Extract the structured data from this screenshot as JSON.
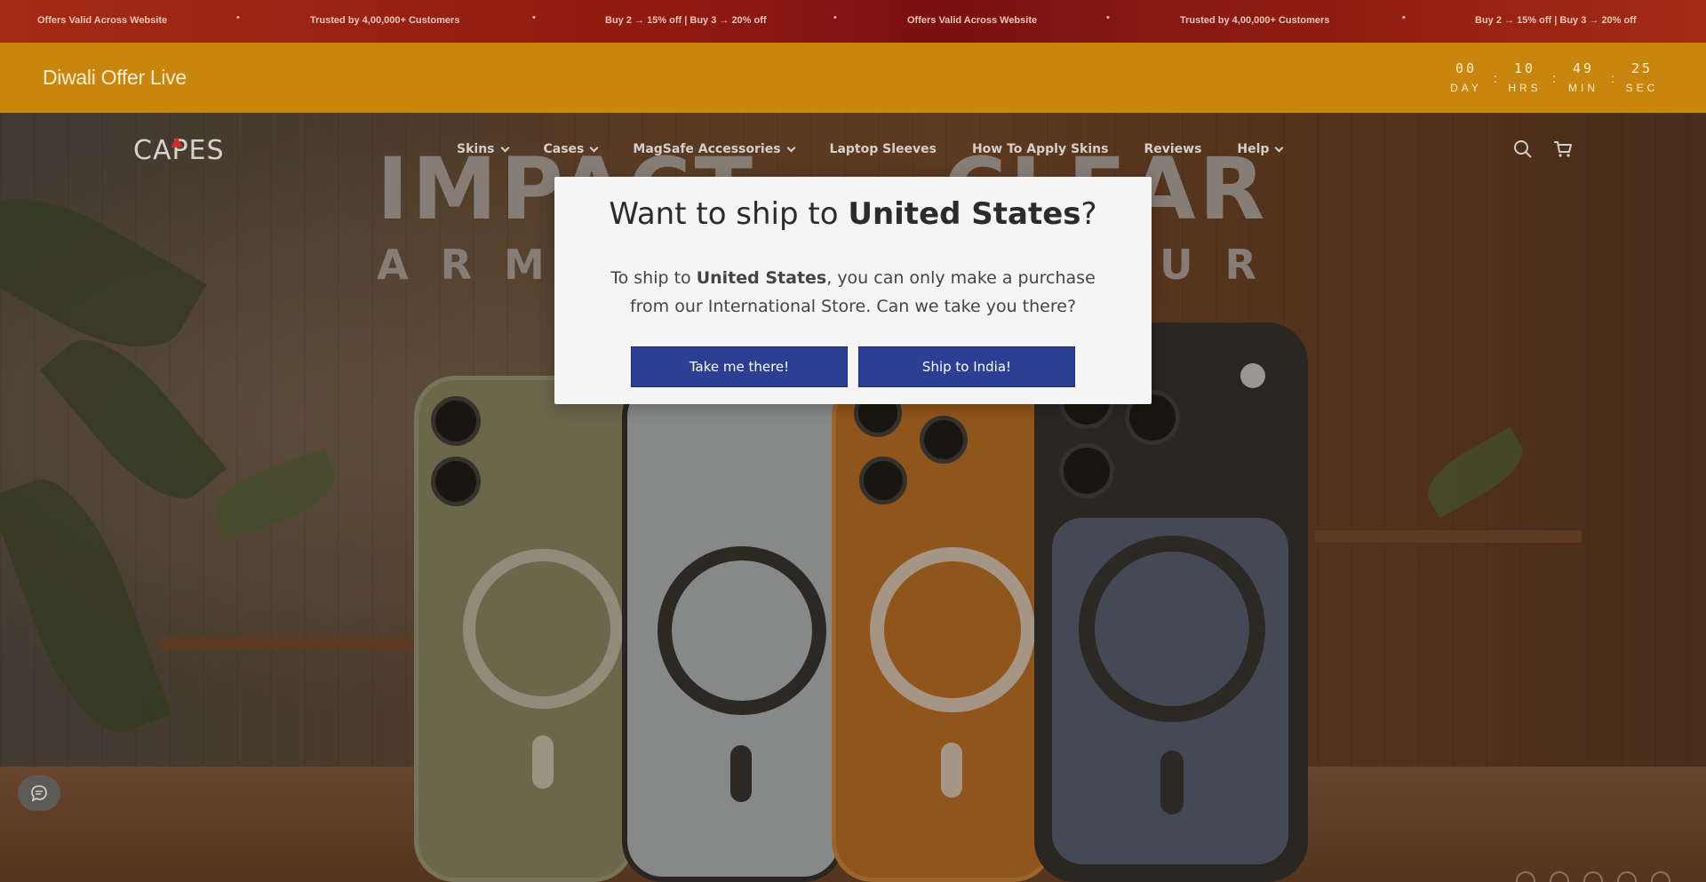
{
  "announcement": {
    "items": [
      "Offers Valid Across Website",
      "Trusted by 4,00,000+ Customers",
      "Buy 2 → 15% off | Buy 3 → 20% off",
      "Offers Valid Across Website",
      "Trusted by 4,00,000+ Customers",
      "Buy 2 → 15% off | Buy 3 → 20% off"
    ],
    "separator": "•"
  },
  "offer": {
    "title": "Diwali Offer Live",
    "countdown": [
      {
        "value": "00",
        "label": "DAY"
      },
      {
        "value": "10",
        "label": "HRS"
      },
      {
        "value": "49",
        "label": "MIN"
      },
      {
        "value": "25",
        "label": "SEC"
      }
    ],
    "separator": ":"
  },
  "header": {
    "logo": "CAPES",
    "nav": [
      {
        "label": "Skins",
        "dropdown": true
      },
      {
        "label": "Cases",
        "dropdown": true
      },
      {
        "label": "MagSafe Accessories",
        "dropdown": true
      },
      {
        "label": "Laptop Sleeves",
        "dropdown": false
      },
      {
        "label": "How To Apply Skins",
        "dropdown": false
      },
      {
        "label": "Reviews",
        "dropdown": false
      },
      {
        "label": "Help",
        "dropdown": true
      }
    ],
    "icons": [
      "search-icon",
      "cart-icon"
    ]
  },
  "hero": {
    "headline_left": "IMPACT",
    "headline_right": "CLEAR",
    "sub_left": "ARM",
    "sub_right": "OUR"
  },
  "modal": {
    "title_pre": "Want to ship to ",
    "title_country": "United States",
    "title_post": "?",
    "body_pre": "To ship to ",
    "body_country": "United States",
    "body_post": ", you can only make a purchase from our International Store. Can we take you there?",
    "primary_button": "Take me there!",
    "secondary_button": "Ship to India!"
  },
  "colors": {
    "announcement_bg": "#8e1a12",
    "offer_bg": "#c8860f",
    "button_bg": "#2d3f94",
    "modal_bg": "#f5f5f5"
  }
}
